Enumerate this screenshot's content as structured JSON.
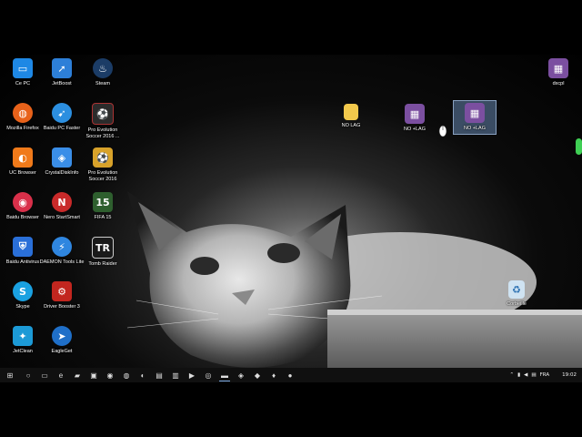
{
  "desktop": {
    "icons_col1": [
      {
        "label": "Ce PC",
        "icon": "computer-icon",
        "color": "#1e88e5"
      },
      {
        "label": "Mozilla Firefox",
        "icon": "firefox-icon",
        "color": "#e8621a"
      },
      {
        "label": "UC Browser",
        "icon": "uc-browser-icon",
        "color": "#f07a1a"
      },
      {
        "label": "Baidu Browser",
        "icon": "baidu-browser-icon",
        "color": "#d9304a"
      },
      {
        "label": "Baidu Antivirus",
        "icon": "shield-icon",
        "color": "#2a6fd8"
      },
      {
        "label": "Skype",
        "icon": "skype-icon",
        "color": "#1aa1e1"
      },
      {
        "label": "JetClean",
        "icon": "jetclean-icon",
        "color": "#1c9ad6"
      }
    ],
    "icons_col2": [
      {
        "label": "JetBoost",
        "icon": "jetboost-icon",
        "color": "#2d7fd8"
      },
      {
        "label": "Baidu PC Faster",
        "icon": "rocket-icon",
        "color": "#2c8fe0"
      },
      {
        "label": "CrystalDiskInfo",
        "icon": "disk-icon",
        "color": "#3a8ee8"
      },
      {
        "label": "Nero StartSmart",
        "icon": "nero-icon",
        "color": "#c92a2a"
      },
      {
        "label": "DAEMON Tools Lite",
        "icon": "daemon-tools-icon",
        "color": "#2f86e0"
      },
      {
        "label": "Driver Booster 3",
        "icon": "driver-booster-icon",
        "color": "#c2261f"
      },
      {
        "label": "EagleGet",
        "icon": "eagleget-icon",
        "color": "#1f6fc8"
      }
    ],
    "icons_col3": [
      {
        "label": "Steam",
        "icon": "steam-icon",
        "color": "#1b3c66"
      },
      {
        "label": "Pro Evolution Soccer 2016 ...",
        "icon": "pes-icon",
        "color": "#2b2b2b"
      },
      {
        "label": "Pro Evolution Soccer 2016",
        "icon": "pes-icon",
        "color": "#d8a22a"
      },
      {
        "label": "FIFA 15",
        "icon": "fifa-icon",
        "color": "#2e5f2e"
      },
      {
        "label": "Tomb Raider",
        "icon": "tomb-raider-icon",
        "color": "#1a1a1a"
      }
    ],
    "icons_mid": [
      {
        "label": "NO LAG",
        "icon": "folder-icon",
        "color": "#f2c94c"
      },
      {
        "label": "NO +LAG",
        "icon": "winrar-icon",
        "color": "#7b4fa0"
      },
      {
        "label": "NO +LAG",
        "icon": "winrar-icon",
        "color": "#7b4fa0"
      }
    ],
    "icon_right": {
      "label": "dxcpl",
      "icon": "winrar-icon",
      "color": "#7b4fa0"
    },
    "recycle_bin": {
      "label": "Corbeille",
      "icon": "recycle-bin-icon"
    }
  },
  "taskbar": {
    "buttons": [
      {
        "icon": "windows-start-icon",
        "glyph": "⊞"
      },
      {
        "icon": "search-icon",
        "glyph": "○"
      },
      {
        "icon": "task-view-icon",
        "glyph": "▭"
      },
      {
        "icon": "edge-icon",
        "glyph": "e"
      },
      {
        "icon": "file-explorer-icon",
        "glyph": "▰"
      },
      {
        "icon": "store-icon",
        "glyph": "▣"
      },
      {
        "icon": "chrome-icon",
        "glyph": "◉"
      },
      {
        "icon": "firefox-icon",
        "glyph": "◍"
      },
      {
        "icon": "uc-browser-icon",
        "glyph": "◐"
      },
      {
        "icon": "app-icon",
        "glyph": "▤"
      },
      {
        "icon": "app-icon",
        "glyph": "▥"
      },
      {
        "icon": "app-icon",
        "glyph": "▶"
      },
      {
        "icon": "app-icon",
        "glyph": "◎"
      },
      {
        "icon": "active-app-icon",
        "glyph": "▬"
      },
      {
        "icon": "app-icon",
        "glyph": "◈"
      },
      {
        "icon": "app-icon",
        "glyph": "◆"
      },
      {
        "icon": "app-icon",
        "glyph": "♦"
      },
      {
        "icon": "app-icon",
        "glyph": "●"
      }
    ],
    "tray": {
      "language": "FRA",
      "time": "19:02"
    }
  }
}
